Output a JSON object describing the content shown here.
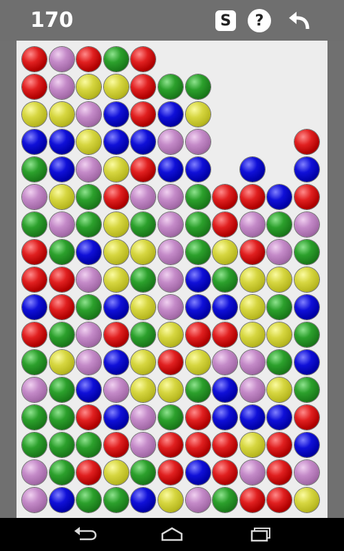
{
  "header": {
    "score": "170",
    "s_button_label": "S",
    "help_button_label": "?"
  },
  "icons": {
    "undo": "undo-arrow-icon",
    "back": "back-icon",
    "home": "home-icon",
    "recent": "recent-apps-icon"
  },
  "colors": {
    "red": "#d01818",
    "green": "#259b25",
    "blue": "#0a0acc",
    "yellow": "#d0d040",
    "purple": "#c08cc4",
    "board_background": "#ededed",
    "header_background": "#6f6f6f"
  },
  "board": {
    "columns": 11,
    "rows": 17,
    "grid": [
      [
        "R",
        "P",
        "R",
        "G",
        "R",
        null,
        null,
        null,
        null,
        null,
        null
      ],
      [
        "R",
        "P",
        "Y",
        "Y",
        "R",
        "G",
        "G",
        null,
        null,
        null,
        null
      ],
      [
        "Y",
        "Y",
        "P",
        "B",
        "R",
        "B",
        "Y",
        null,
        null,
        null,
        null
      ],
      [
        "B",
        "B",
        "Y",
        "B",
        "B",
        "P",
        "P",
        null,
        null,
        null,
        "R"
      ],
      [
        "G",
        "B",
        "P",
        "Y",
        "R",
        "B",
        "B",
        null,
        "B",
        null,
        "B"
      ],
      [
        "P",
        "Y",
        "G",
        "R",
        "P",
        "P",
        "G",
        "R",
        "R",
        "B",
        "R"
      ],
      [
        "G",
        "P",
        "G",
        "Y",
        "G",
        "P",
        "G",
        "R",
        "P",
        "G",
        "P"
      ],
      [
        "R",
        "G",
        "B",
        "Y",
        "Y",
        "P",
        "G",
        "Y",
        "R",
        "P",
        "G"
      ],
      [
        "R",
        "R",
        "P",
        "Y",
        "G",
        "P",
        "B",
        "G",
        "Y",
        "Y",
        "Y"
      ],
      [
        "B",
        "R",
        "G",
        "B",
        "Y",
        "P",
        "B",
        "B",
        "Y",
        "G",
        "B"
      ],
      [
        "R",
        "G",
        "P",
        "R",
        "G",
        "Y",
        "R",
        "R",
        "Y",
        "Y",
        "G"
      ],
      [
        "G",
        "Y",
        "P",
        "B",
        "Y",
        "R",
        "Y",
        "P",
        "P",
        "G",
        "B"
      ],
      [
        "P",
        "G",
        "B",
        "P",
        "Y",
        "Y",
        "G",
        "B",
        "P",
        "Y",
        "G"
      ],
      [
        "G",
        "G",
        "R",
        "B",
        "P",
        "G",
        "R",
        "B",
        "B",
        "B",
        "R"
      ],
      [
        "G",
        "G",
        "G",
        "R",
        "P",
        "R",
        "R",
        "R",
        "Y",
        "R",
        "B"
      ],
      [
        "P",
        "G",
        "R",
        "Y",
        "G",
        "R",
        "B",
        "R",
        "P",
        "R",
        "P"
      ],
      [
        "P",
        "B",
        "G",
        "G",
        "B",
        "Y",
        "P",
        "G",
        "R",
        "R",
        "Y"
      ]
    ]
  }
}
